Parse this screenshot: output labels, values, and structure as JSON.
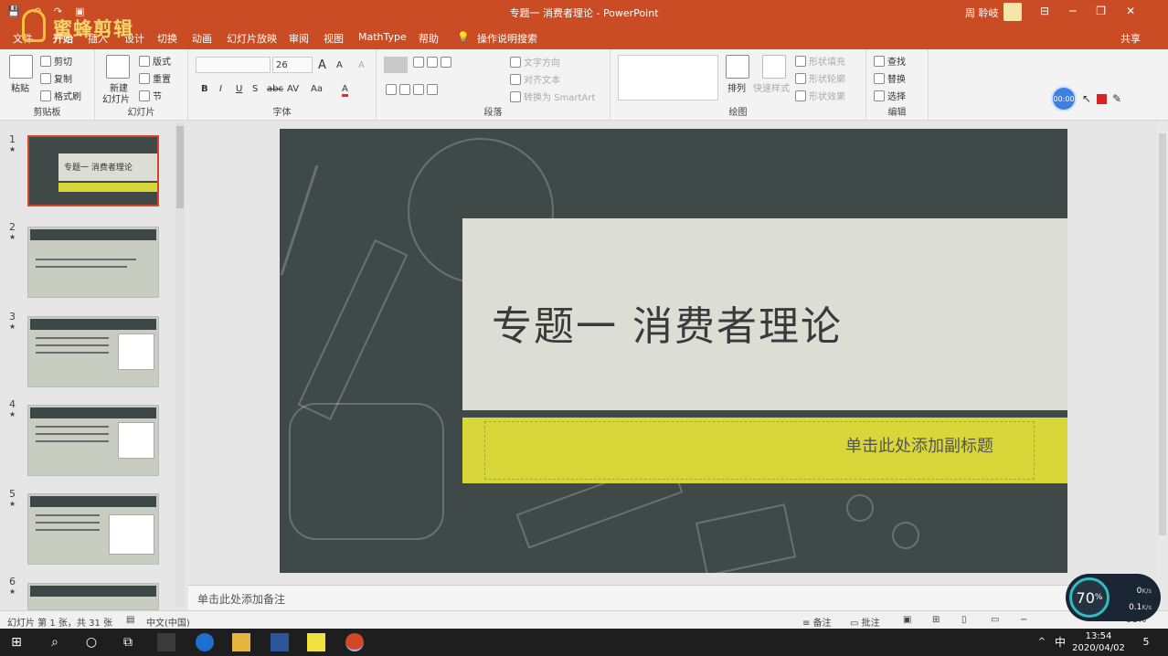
{
  "window": {
    "title": "专题一 消费者理论 - PowerPoint",
    "user": "周 聆岐",
    "minimize": "─",
    "restore": "❐",
    "close": "✕",
    "ribbon_toggle": "⊟"
  },
  "quick_access": {
    "save": "💾",
    "undo": "↶",
    "redo": "↷",
    "present": "▣"
  },
  "watermark": {
    "text": "蜜蜂剪辑"
  },
  "tabs": [
    {
      "label": "文件"
    },
    {
      "label": "开始"
    },
    {
      "label": "插入"
    },
    {
      "label": "设计"
    },
    {
      "label": "切换"
    },
    {
      "label": "动画"
    },
    {
      "label": "幻灯片放映"
    },
    {
      "label": "审阅"
    },
    {
      "label": "视图"
    },
    {
      "label": "MathType"
    },
    {
      "label": "帮助"
    },
    {
      "label": "操作说明搜索"
    }
  ],
  "share_label": "共享",
  "ribbon": {
    "clipboard": {
      "paste": "粘贴",
      "cut": "剪切",
      "copy": "复制",
      "format_painter": "格式刷",
      "group": "剪贴板"
    },
    "slides": {
      "new_slide": "新建",
      "new_slide2": "幻灯片",
      "layout": "版式",
      "reset": "重置",
      "section": "节",
      "group": "幻灯片"
    },
    "font": {
      "size": "26",
      "bold": "B",
      "italic": "I",
      "underline": "U",
      "shadow": "S",
      "strike": "abc",
      "spacing": "AV",
      "case": "Aa",
      "color": "A",
      "grow": "A",
      "shrink": "A",
      "clear": "A",
      "group": "字体"
    },
    "paragraph": {
      "text_direction": "文字方向",
      "align_text": "对齐文本",
      "smartart": "转换为 SmartArt",
      "group": "段落"
    },
    "drawing": {
      "arrange": "排列",
      "quick_styles": "快速样式",
      "shape_fill": "形状填充",
      "shape_outline": "形状轮廓",
      "shape_effects": "形状效果",
      "group": "绘图"
    },
    "editing": {
      "find": "查找",
      "replace": "替换",
      "select": "选择",
      "group": "编辑"
    }
  },
  "recorder": {
    "time": "00:00"
  },
  "thumbnails": [
    {
      "num": "1",
      "star": "★",
      "title": "专题一 消费者理论"
    },
    {
      "num": "2",
      "star": "★"
    },
    {
      "num": "3",
      "star": "★"
    },
    {
      "num": "4",
      "star": "★"
    },
    {
      "num": "5",
      "star": "★"
    },
    {
      "num": "6",
      "star": "★"
    }
  ],
  "slide": {
    "title": "专题一 消费者理论",
    "subtitle_placeholder": "单击此处添加副标题"
  },
  "notes_placeholder": "单击此处添加备注",
  "status": {
    "slide_info": "幻灯片 第 1 张，共 31 张",
    "language": "中文(中国)",
    "notes": "备注",
    "comments": "批注",
    "zoom": "81%",
    "zoom_minus": "−",
    "zoom_plus": "+"
  },
  "net_monitor": {
    "percent": "70",
    "unit": "%",
    "up": "0",
    "down": "0.1",
    "rate_unit": "K/s"
  },
  "taskbar": {
    "time": "13:54",
    "date": "2020/04/02",
    "ime": "中",
    "notify": "5",
    "start": "⊞",
    "search": "⌕",
    "cortana": "○",
    "taskview": "⧉",
    "up_arrow": "^"
  },
  "colors": {
    "accent": "#c94c24",
    "slide_bg": "#3f4a48",
    "slide_title_box": "#dcded5",
    "slide_yellow": "#d9d63a"
  }
}
